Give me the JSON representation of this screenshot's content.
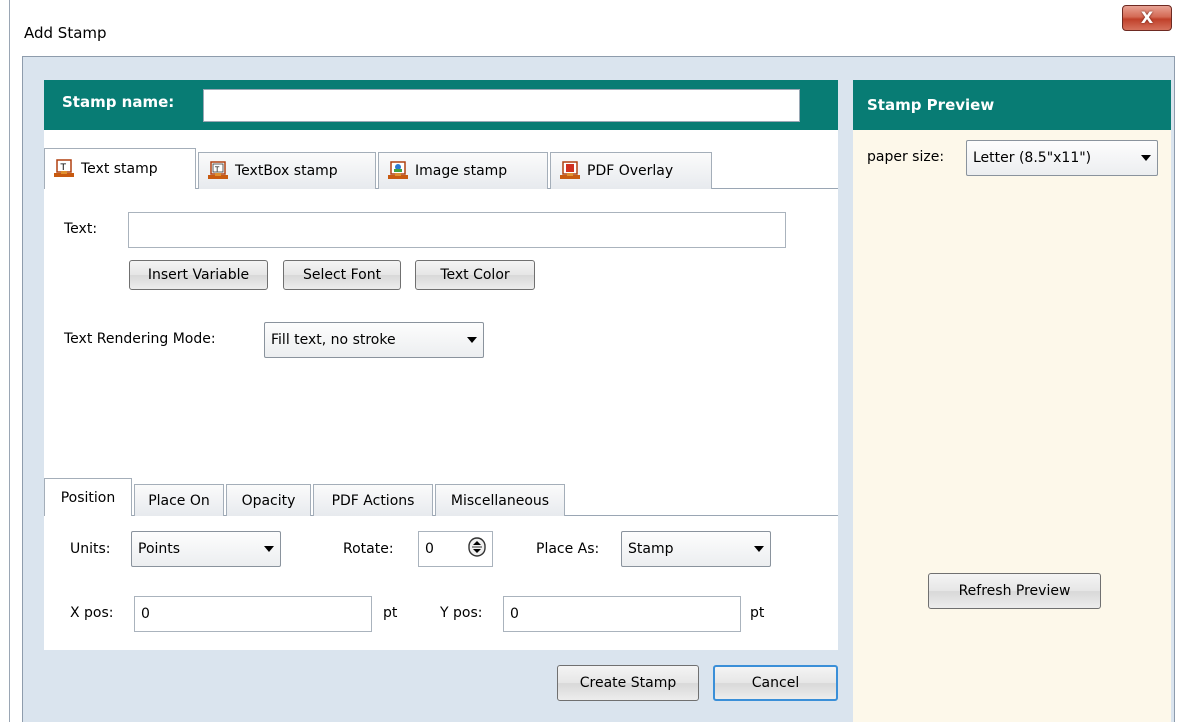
{
  "window": {
    "title": "Add Stamp",
    "close_glyph": "X"
  },
  "stamp_name": {
    "label": "Stamp name:",
    "value": ""
  },
  "main_tabs": [
    {
      "label": "Text stamp",
      "icon": "stamp-text-icon"
    },
    {
      "label": "TextBox stamp",
      "icon": "stamp-textbox-icon"
    },
    {
      "label": "Image stamp",
      "icon": "stamp-image-icon"
    },
    {
      "label": "PDF Overlay",
      "icon": "stamp-pdf-icon"
    }
  ],
  "text_section": {
    "text_label": "Text:",
    "text_value": "",
    "insert_variable": "Insert Variable",
    "select_font": "Select Font",
    "text_color": "Text Color",
    "rendering_label": "Text Rendering Mode:",
    "rendering_value": "Fill text, no stroke"
  },
  "sub_tabs": [
    "Position",
    "Place On",
    "Opacity",
    "PDF Actions",
    "Miscellaneous"
  ],
  "position": {
    "units_label": "Units:",
    "units_value": "Points",
    "rotate_label": "Rotate:",
    "rotate_value": "0",
    "place_as_label": "Place As:",
    "place_as_value": "Stamp",
    "x_label": "X pos:",
    "x_value": "0",
    "x_unit": "pt",
    "y_label": "Y pos:",
    "y_value": "0",
    "y_unit": "pt"
  },
  "footer": {
    "create": "Create Stamp",
    "cancel": "Cancel"
  },
  "preview": {
    "title": "Stamp Preview",
    "paper_label": "paper size:",
    "paper_value": "Letter (8.5\"x11\")",
    "refresh": "Refresh Preview"
  },
  "colors": {
    "teal": "#087c74",
    "preview_bg": "#fdf8ea",
    "frame": "#dae4ee"
  }
}
